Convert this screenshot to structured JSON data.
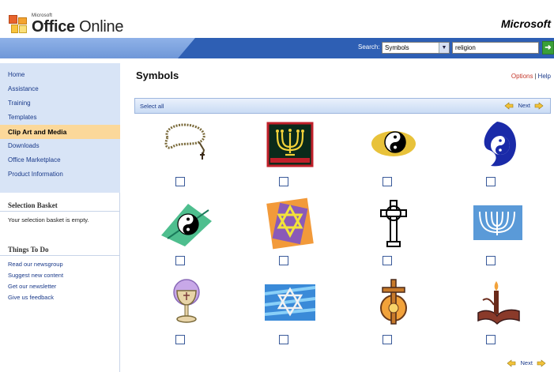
{
  "header": {
    "logo_small": "Microsoft",
    "logo_text_part1": "Office",
    "logo_text_part2": " Online",
    "brand": "Microsoft"
  },
  "search": {
    "label": "Search:",
    "scope": "Symbols",
    "query": "religion"
  },
  "nav": {
    "items": [
      {
        "label": "Home"
      },
      {
        "label": "Assistance"
      },
      {
        "label": "Training"
      },
      {
        "label": "Templates"
      },
      {
        "label": "Clip Art and Media"
      },
      {
        "label": "Downloads"
      },
      {
        "label": "Office Marketplace"
      },
      {
        "label": "Product Information"
      }
    ],
    "active_index": 4
  },
  "selection_basket": {
    "title": "Selection Basket",
    "text": "Your selection basket is empty."
  },
  "things_to_do": {
    "title": "Things To Do",
    "links": [
      {
        "label": "Read our newsgroup"
      },
      {
        "label": "Suggest new content"
      },
      {
        "label": "Get our newsletter"
      },
      {
        "label": "Give us feedback"
      }
    ]
  },
  "main": {
    "title": "Symbols",
    "options_link": "Options",
    "help_link": "Help",
    "select_all": "Select all",
    "next": "Next",
    "bottom_next": "Next"
  },
  "clipart": [
    {
      "icon": "rosary-icon"
    },
    {
      "icon": "menorah-icon"
    },
    {
      "icon": "yin-yang-icon"
    },
    {
      "icon": "yin-yang-star-icon"
    },
    {
      "icon": "yin-yang-star-icon"
    },
    {
      "icon": "star-of-david-icon"
    },
    {
      "icon": "celtic-cross-icon"
    },
    {
      "icon": "menorah-icon"
    },
    {
      "icon": "chalice-icon"
    },
    {
      "icon": "star-of-david-icon"
    },
    {
      "icon": "cross-icon"
    },
    {
      "icon": "candle-book-icon"
    }
  ],
  "colors": {
    "accent_blue": "#2e5fb4",
    "nav_bg": "#d8e4f6",
    "active_nav": "#fbd89a",
    "link": "#1a3a8a",
    "options_link": "#c4372a"
  }
}
